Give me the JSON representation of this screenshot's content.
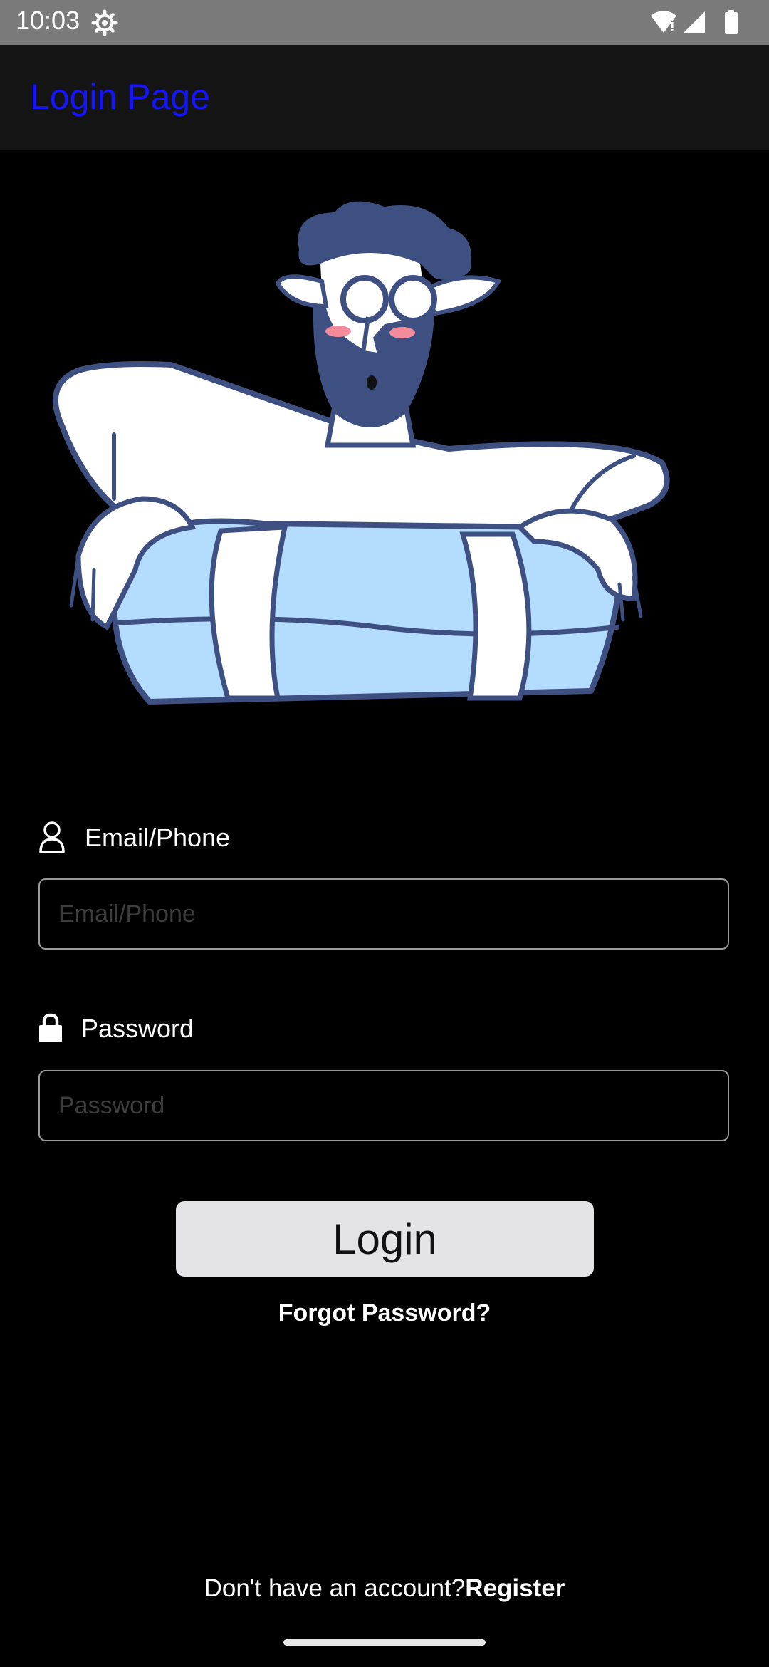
{
  "status_bar": {
    "time": "10:03",
    "icons": [
      "gear-icon",
      "wifi-icon",
      "signal-icon",
      "battery-icon"
    ]
  },
  "app_bar": {
    "title": "Login Page",
    "title_color": "#1414ff"
  },
  "illustration": {
    "icon": "man-on-float-illustration"
  },
  "form": {
    "email": {
      "label": "Email/Phone",
      "placeholder": "Email/Phone",
      "value": "",
      "icon": "user-icon"
    },
    "password": {
      "label": "Password",
      "placeholder": "Password",
      "value": "",
      "icon": "lock-icon"
    },
    "login_label": "Login",
    "forgot_label": "Forgot Password?"
  },
  "footer": {
    "prompt": "Don't have an account?",
    "register_label": "Register"
  }
}
